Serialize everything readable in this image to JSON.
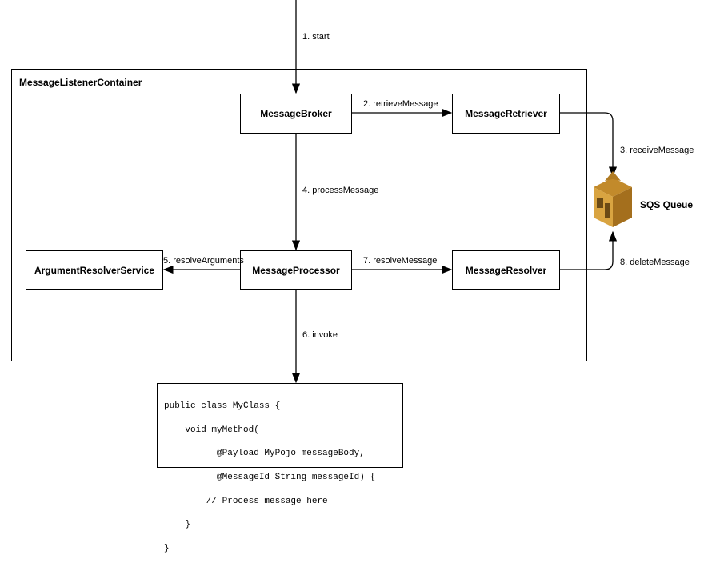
{
  "container": {
    "label": "MessageListenerContainer"
  },
  "nodes": {
    "broker": "MessageBroker",
    "retriever": "MessageRetriever",
    "processor": "MessageProcessor",
    "argresolver": "ArgumentResolverService",
    "resolver": "MessageResolver",
    "sqs": "SQS Queue"
  },
  "edges": {
    "start": "1. start",
    "retrieve": "2. retrieveMessage",
    "receive": "3. receiveMessage",
    "process": "4. processMessage",
    "resolveArgs": "5. resolveArguments",
    "invoke": "6. invoke",
    "resolveMsg": "7. resolveMessage",
    "deleteMsg": "8. deleteMessage"
  },
  "code": {
    "line1": "public class MyClass {",
    "line2": "    void myMethod(",
    "line3": "          @Payload MyPojo messageBody,",
    "line4": "          @MessageId String messageId) {",
    "line5": "        // Process message here",
    "line6": "    }",
    "line7": "}"
  }
}
